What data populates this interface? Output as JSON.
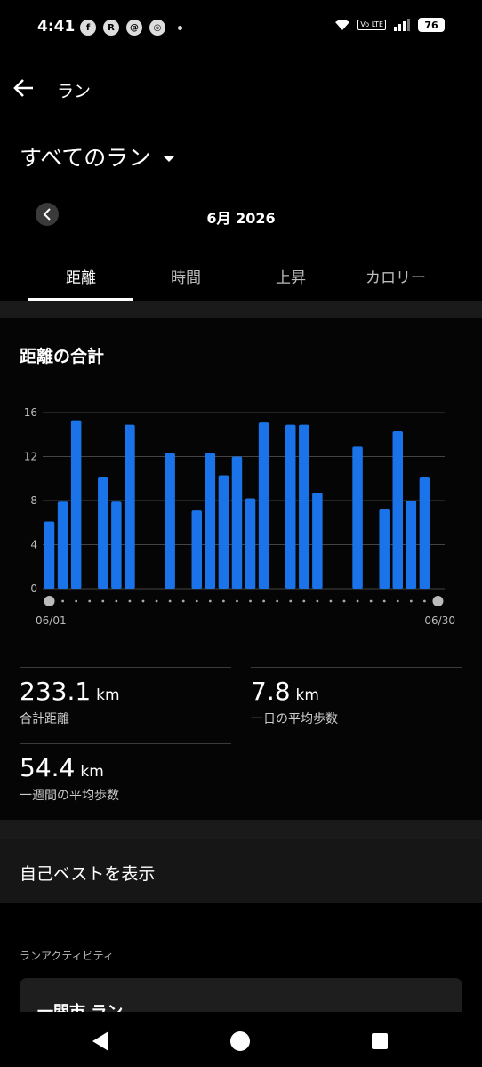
{
  "status": {
    "time": "4:41",
    "battery": "76",
    "volte_label": "Vo LTE"
  },
  "topbar": {
    "title": "ラン"
  },
  "filter": {
    "label": "すべてのラン"
  },
  "month": {
    "label": "6月 2026"
  },
  "tabs": [
    {
      "label": "距離"
    },
    {
      "label": "時間"
    },
    {
      "label": "上昇"
    },
    {
      "label": "カロリー"
    }
  ],
  "card": {
    "title": "距離の合計"
  },
  "chart_data": {
    "type": "bar",
    "title": "距離の合計",
    "ylim": [
      0,
      16
    ],
    "yticks": [
      "0",
      "4",
      "8",
      "12",
      "16"
    ],
    "x_start_label": "06/01",
    "x_end_label": "06/30",
    "categories": [
      1,
      2,
      3,
      4,
      5,
      6,
      7,
      8,
      9,
      10,
      11,
      12,
      13,
      14,
      15,
      16,
      17,
      18,
      19,
      20,
      21,
      22,
      23,
      24,
      25,
      26,
      27,
      28,
      29,
      30
    ],
    "values": [
      6.1,
      7.9,
      15.3,
      0,
      10.1,
      7.9,
      14.9,
      0,
      0,
      12.3,
      0,
      7.1,
      12.3,
      10.3,
      12.0,
      8.2,
      15.1,
      0,
      14.9,
      14.9,
      8.7,
      0,
      0,
      12.9,
      0,
      7.2,
      14.3,
      8.0,
      10.1,
      0
    ],
    "bar_color": "#1a73e8",
    "grid": true
  },
  "stats": {
    "total": {
      "value": "233.1",
      "unit": "km",
      "label": "合計距離"
    },
    "daily_avg": {
      "value": "7.8",
      "unit": "km",
      "label": "一日の平均歩数"
    },
    "weekly_avg": {
      "value": "54.4",
      "unit": "km",
      "label": "一週間の平均歩数"
    }
  },
  "personal_best": {
    "label": "自己ベストを表示"
  },
  "activities": {
    "header": "ランアクティビティ",
    "first_title": "一関市 ラン"
  }
}
